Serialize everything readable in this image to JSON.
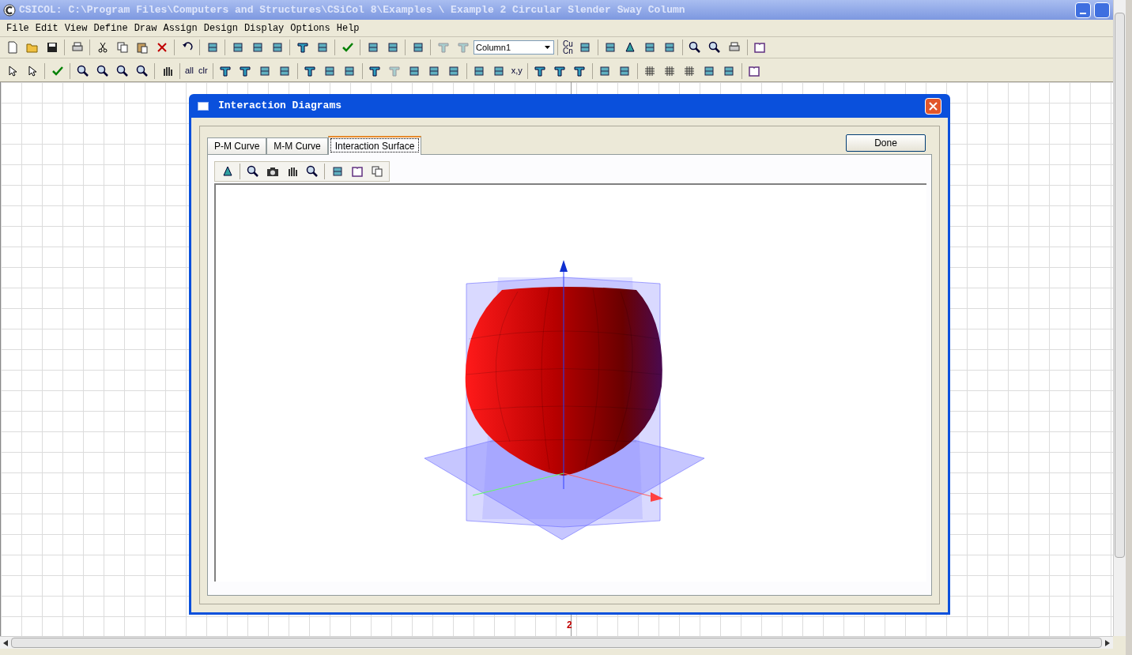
{
  "window": {
    "title": "CSICOL: C:\\Program Files\\Computers and Structures\\CSiCol 8\\Examples \\ Example 2 Circular Slender Sway Column"
  },
  "menu": [
    "File",
    "Edit",
    "View",
    "Define",
    "Draw",
    "Assign",
    "Design",
    "Display",
    "Options",
    "Help"
  ],
  "toolbar": {
    "section_dropdown": {
      "value": "Column1"
    },
    "icon_captions": [
      "Cu",
      "Cn",
      "all",
      "clr",
      "x,y"
    ]
  },
  "canvas": {
    "grid_label": "2"
  },
  "dialog": {
    "title": "Interaction Diagrams",
    "tabs": [
      {
        "label": "P-M Curve",
        "selected": false
      },
      {
        "label": "M-M Curve",
        "selected": false
      },
      {
        "label": "Interaction Surface",
        "selected": true
      }
    ],
    "done_button": "Done"
  }
}
